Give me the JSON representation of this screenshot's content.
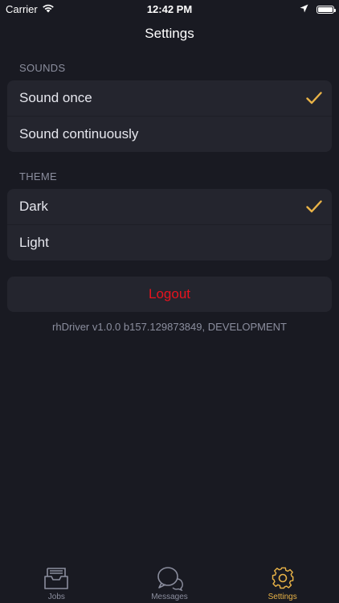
{
  "status_bar": {
    "carrier": "Carrier",
    "time": "12:42 PM",
    "battery_level": 1.0
  },
  "nav": {
    "title": "Settings"
  },
  "sounds": {
    "header": "SOUNDS",
    "options": [
      {
        "label": "Sound once",
        "selected": true
      },
      {
        "label": "Sound continuously",
        "selected": false
      }
    ]
  },
  "theme": {
    "header": "THEME",
    "options": [
      {
        "label": "Dark",
        "selected": true
      },
      {
        "label": "Light",
        "selected": false
      }
    ]
  },
  "logout": {
    "label": "Logout"
  },
  "version": {
    "text": "rhDriver v1.0.0 b157.129873849, DEVELOPMENT"
  },
  "tabs": [
    {
      "label": "Jobs",
      "icon": "inbox-icon",
      "active": false
    },
    {
      "label": "Messages",
      "icon": "chat-bubbles-icon",
      "active": false
    },
    {
      "label": "Settings",
      "icon": "gear-icon",
      "active": true
    }
  ],
  "colors": {
    "background": "#191a22",
    "card": "#24252e",
    "accent": "#e9b347",
    "destructive": "#e8131e",
    "muted": "#8b8e9e"
  }
}
